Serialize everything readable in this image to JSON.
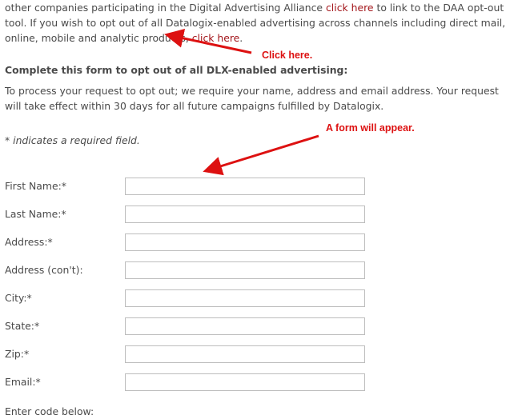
{
  "intro": {
    "text1": "other companies participating in the Digital Advertising Alliance ",
    "link1": "click here",
    "text2": " to link to the DAA opt-out tool. If you wish to opt out of all Datalogix-enabled advertising across channels including direct mail, online, mobile and analytic products, ",
    "link2": "click here",
    "text3": "."
  },
  "heading": "Complete this form to opt out of all DLX-enabled advertising:",
  "process_text": "To process your request to opt out; we require your name, address and email address. Your request will take effect within 30 days for all future campaigns fulfilled by Datalogix.",
  "required_note": "* indicates a required field.",
  "form": {
    "fields": [
      {
        "label": "First Name:*",
        "value": ""
      },
      {
        "label": "Last Name:*",
        "value": ""
      },
      {
        "label": "Address:*",
        "value": ""
      },
      {
        "label": "Address (con't):",
        "value": ""
      },
      {
        "label": "City:*",
        "value": ""
      },
      {
        "label": "State:*",
        "value": ""
      },
      {
        "label": "Zip:*",
        "value": ""
      },
      {
        "label": "Email:*",
        "value": ""
      }
    ],
    "code_label": "Enter code below:"
  },
  "annotations": {
    "click_here": "Click here.",
    "form_appear": "A form will appear.",
    "color": "#dd1111"
  },
  "colors": {
    "link": "#a3161b",
    "text": "#4a4a4a",
    "input_border": "#bdbdbd"
  }
}
